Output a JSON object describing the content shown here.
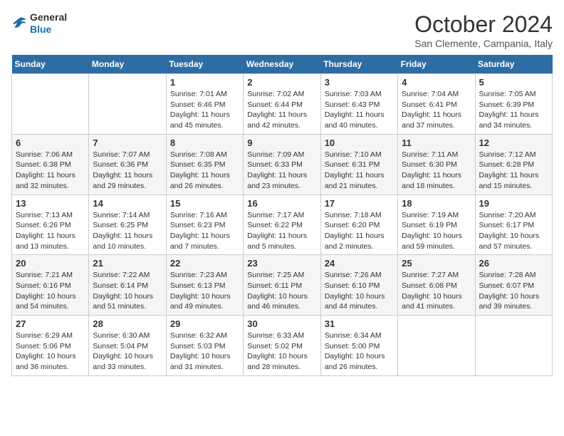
{
  "header": {
    "logo_general": "General",
    "logo_blue": "Blue",
    "month_title": "October 2024",
    "location": "San Clemente, Campania, Italy"
  },
  "days_of_week": [
    "Sunday",
    "Monday",
    "Tuesday",
    "Wednesday",
    "Thursday",
    "Friday",
    "Saturday"
  ],
  "weeks": [
    [
      {
        "day": "",
        "info": ""
      },
      {
        "day": "",
        "info": ""
      },
      {
        "day": "1",
        "info": "Sunrise: 7:01 AM\nSunset: 6:46 PM\nDaylight: 11 hours and 45 minutes."
      },
      {
        "day": "2",
        "info": "Sunrise: 7:02 AM\nSunset: 6:44 PM\nDaylight: 11 hours and 42 minutes."
      },
      {
        "day": "3",
        "info": "Sunrise: 7:03 AM\nSunset: 6:43 PM\nDaylight: 11 hours and 40 minutes."
      },
      {
        "day": "4",
        "info": "Sunrise: 7:04 AM\nSunset: 6:41 PM\nDaylight: 11 hours and 37 minutes."
      },
      {
        "day": "5",
        "info": "Sunrise: 7:05 AM\nSunset: 6:39 PM\nDaylight: 11 hours and 34 minutes."
      }
    ],
    [
      {
        "day": "6",
        "info": "Sunrise: 7:06 AM\nSunset: 6:38 PM\nDaylight: 11 hours and 32 minutes."
      },
      {
        "day": "7",
        "info": "Sunrise: 7:07 AM\nSunset: 6:36 PM\nDaylight: 11 hours and 29 minutes."
      },
      {
        "day": "8",
        "info": "Sunrise: 7:08 AM\nSunset: 6:35 PM\nDaylight: 11 hours and 26 minutes."
      },
      {
        "day": "9",
        "info": "Sunrise: 7:09 AM\nSunset: 6:33 PM\nDaylight: 11 hours and 23 minutes."
      },
      {
        "day": "10",
        "info": "Sunrise: 7:10 AM\nSunset: 6:31 PM\nDaylight: 11 hours and 21 minutes."
      },
      {
        "day": "11",
        "info": "Sunrise: 7:11 AM\nSunset: 6:30 PM\nDaylight: 11 hours and 18 minutes."
      },
      {
        "day": "12",
        "info": "Sunrise: 7:12 AM\nSunset: 6:28 PM\nDaylight: 11 hours and 15 minutes."
      }
    ],
    [
      {
        "day": "13",
        "info": "Sunrise: 7:13 AM\nSunset: 6:26 PM\nDaylight: 11 hours and 13 minutes."
      },
      {
        "day": "14",
        "info": "Sunrise: 7:14 AM\nSunset: 6:25 PM\nDaylight: 11 hours and 10 minutes."
      },
      {
        "day": "15",
        "info": "Sunrise: 7:16 AM\nSunset: 6:23 PM\nDaylight: 11 hours and 7 minutes."
      },
      {
        "day": "16",
        "info": "Sunrise: 7:17 AM\nSunset: 6:22 PM\nDaylight: 11 hours and 5 minutes."
      },
      {
        "day": "17",
        "info": "Sunrise: 7:18 AM\nSunset: 6:20 PM\nDaylight: 11 hours and 2 minutes."
      },
      {
        "day": "18",
        "info": "Sunrise: 7:19 AM\nSunset: 6:19 PM\nDaylight: 10 hours and 59 minutes."
      },
      {
        "day": "19",
        "info": "Sunrise: 7:20 AM\nSunset: 6:17 PM\nDaylight: 10 hours and 57 minutes."
      }
    ],
    [
      {
        "day": "20",
        "info": "Sunrise: 7:21 AM\nSunset: 6:16 PM\nDaylight: 10 hours and 54 minutes."
      },
      {
        "day": "21",
        "info": "Sunrise: 7:22 AM\nSunset: 6:14 PM\nDaylight: 10 hours and 51 minutes."
      },
      {
        "day": "22",
        "info": "Sunrise: 7:23 AM\nSunset: 6:13 PM\nDaylight: 10 hours and 49 minutes."
      },
      {
        "day": "23",
        "info": "Sunrise: 7:25 AM\nSunset: 6:11 PM\nDaylight: 10 hours and 46 minutes."
      },
      {
        "day": "24",
        "info": "Sunrise: 7:26 AM\nSunset: 6:10 PM\nDaylight: 10 hours and 44 minutes."
      },
      {
        "day": "25",
        "info": "Sunrise: 7:27 AM\nSunset: 6:08 PM\nDaylight: 10 hours and 41 minutes."
      },
      {
        "day": "26",
        "info": "Sunrise: 7:28 AM\nSunset: 6:07 PM\nDaylight: 10 hours and 39 minutes."
      }
    ],
    [
      {
        "day": "27",
        "info": "Sunrise: 6:29 AM\nSunset: 5:06 PM\nDaylight: 10 hours and 36 minutes."
      },
      {
        "day": "28",
        "info": "Sunrise: 6:30 AM\nSunset: 5:04 PM\nDaylight: 10 hours and 33 minutes."
      },
      {
        "day": "29",
        "info": "Sunrise: 6:32 AM\nSunset: 5:03 PM\nDaylight: 10 hours and 31 minutes."
      },
      {
        "day": "30",
        "info": "Sunrise: 6:33 AM\nSunset: 5:02 PM\nDaylight: 10 hours and 28 minutes."
      },
      {
        "day": "31",
        "info": "Sunrise: 6:34 AM\nSunset: 5:00 PM\nDaylight: 10 hours and 26 minutes."
      },
      {
        "day": "",
        "info": ""
      },
      {
        "day": "",
        "info": ""
      }
    ]
  ]
}
